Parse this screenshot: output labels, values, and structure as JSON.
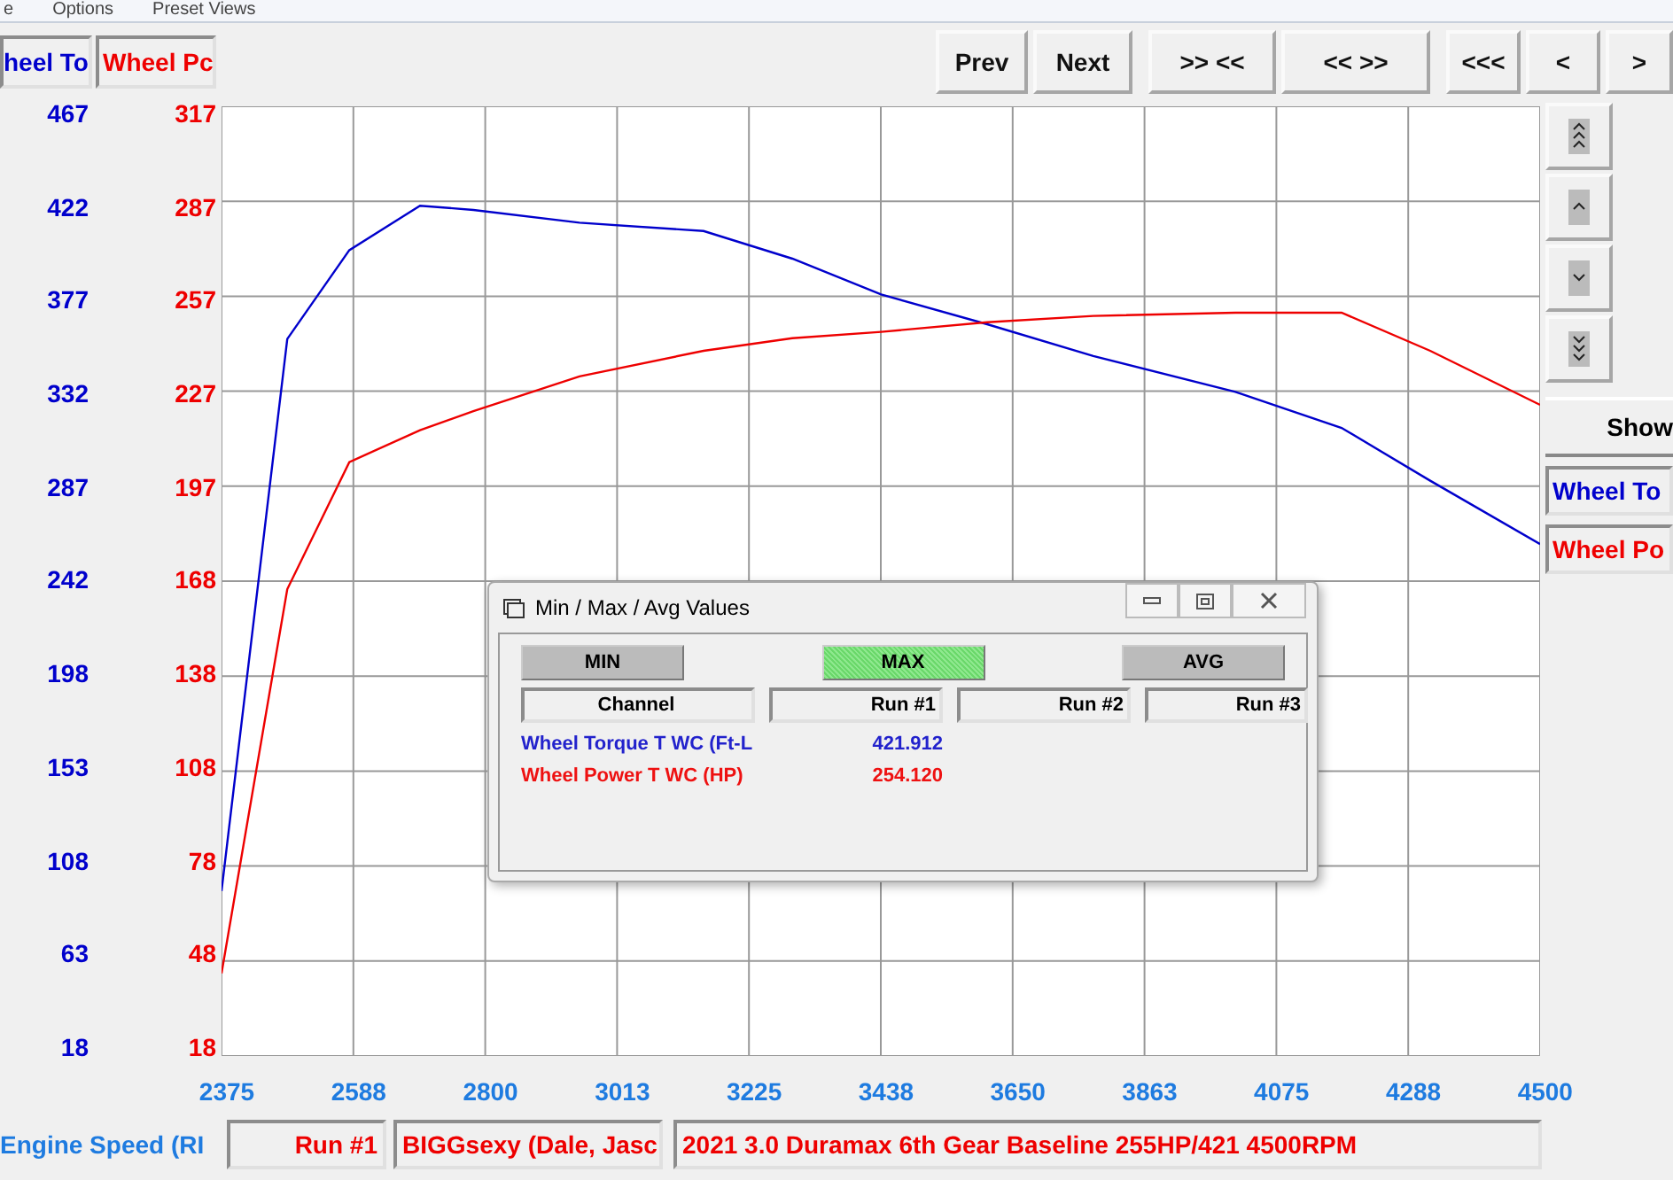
{
  "menu": [
    "e",
    "Options",
    "Preset Views"
  ],
  "header_channels": [
    {
      "label": "heel To",
      "color": "#0000cc"
    },
    {
      "label": "Wheel Pc",
      "color": "#ee0000"
    }
  ],
  "toolbar": [
    "Prev",
    "Next",
    ">> <<",
    "<< >>",
    "<<<",
    "<",
    ">"
  ],
  "chart_data": {
    "type": "line",
    "x": [
      2375,
      2481,
      2581,
      2695,
      2781,
      2952,
      3152,
      3295,
      3438,
      3609,
      3780,
      4009,
      4180,
      4323,
      4500
    ],
    "series": [
      {
        "name": "Wheel To",
        "color": "#0000cc",
        "values": [
          96,
          357,
          399,
          420,
          418,
          412,
          408,
          395,
          378,
          364,
          349,
          332,
          315,
          290,
          260
        ]
      },
      {
        "name": "Wheel Po",
        "color": "#ee0000",
        "axis": "y2",
        "values": [
          44,
          165,
          205,
          215,
          221,
          232,
          240,
          244,
          246,
          249,
          251,
          252,
          252,
          240,
          223
        ]
      }
    ],
    "xlim": [
      2375,
      4500
    ],
    "ylim": [
      18,
      467
    ],
    "y2lim": [
      18,
      317
    ],
    "grid": true,
    "yticks": [
      18,
      63,
      108,
      153,
      198,
      242,
      287,
      332,
      377,
      422,
      467
    ],
    "y2ticks": [
      18,
      48,
      78,
      108,
      138,
      168,
      197,
      227,
      257,
      287,
      317
    ],
    "xticks": [
      {
        "value": 2375,
        "label": "2375"
      },
      {
        "value": 2587.5,
        "label": "2588"
      },
      {
        "value": 2800,
        "label": "2800"
      },
      {
        "value": 3012.5,
        "label": "3013"
      },
      {
        "value": 3225,
        "label": "3225"
      },
      {
        "value": 3437.5,
        "label": "3438"
      },
      {
        "value": 3650,
        "label": "3650"
      },
      {
        "value": 3862.5,
        "label": "3863"
      },
      {
        "value": 4075,
        "label": "4075"
      },
      {
        "value": 4287.5,
        "label": "4288"
      },
      {
        "value": 4500,
        "label": "4500"
      }
    ]
  },
  "side_buttons": [
    {
      "kind": "page-up"
    },
    {
      "kind": "up"
    },
    {
      "kind": "down"
    },
    {
      "kind": "page-down"
    }
  ],
  "show_button": "Show",
  "dialog": {
    "title": "Min / Max / Avg Values",
    "modes": [
      {
        "label": "MIN",
        "selected": false
      },
      {
        "label": "MAX",
        "selected": true
      },
      {
        "label": "AVG",
        "selected": false
      }
    ],
    "columns": [
      "Channel",
      "Run #1",
      "Run #2",
      "Run #3"
    ],
    "rows": [
      {
        "channel": "Wheel Torque T WC (Ft-L",
        "run_1": "421.912",
        "color": "#2222cc"
      },
      {
        "channel": "Wheel Power T WC (HP)",
        "run_1": "254.120",
        "color": "#ee1111"
      }
    ]
  },
  "status_bar": {
    "x_channel": "Engine Speed (RI",
    "run": "Run #1",
    "driver": "BIGGsexy (Dale, Jasc",
    "description": "2021 3.0 Duramax 6th Gear Baseline 255HP/421 4500RPM"
  }
}
